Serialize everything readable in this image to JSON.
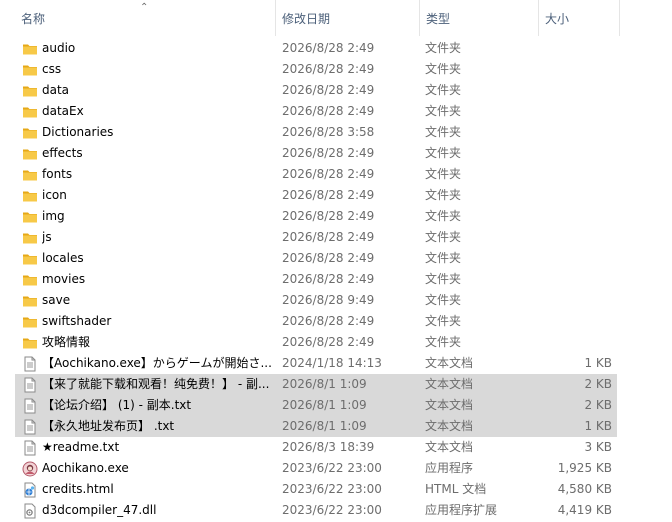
{
  "columns": {
    "name": "名称",
    "date": "修改日期",
    "type": "类型",
    "size": "大小"
  },
  "colors": {
    "folder": "#f7c948",
    "folder_dark": "#e6a817",
    "header_text": "#4c607a",
    "selection": "#d9d9d9"
  },
  "rows": [
    {
      "name": "audio",
      "date": "2026/8/28 2:49",
      "type": "文件夹",
      "size": "",
      "icon": "folder-icon",
      "selected": false
    },
    {
      "name": "css",
      "date": "2026/8/28 2:49",
      "type": "文件夹",
      "size": "",
      "icon": "folder-icon",
      "selected": false
    },
    {
      "name": "data",
      "date": "2026/8/28 2:49",
      "type": "文件夹",
      "size": "",
      "icon": "folder-icon",
      "selected": false
    },
    {
      "name": "dataEx",
      "date": "2026/8/28 2:49",
      "type": "文件夹",
      "size": "",
      "icon": "folder-icon",
      "selected": false
    },
    {
      "name": "Dictionaries",
      "date": "2026/8/28 3:58",
      "type": "文件夹",
      "size": "",
      "icon": "folder-icon",
      "selected": false
    },
    {
      "name": "effects",
      "date": "2026/8/28 2:49",
      "type": "文件夹",
      "size": "",
      "icon": "folder-icon",
      "selected": false
    },
    {
      "name": "fonts",
      "date": "2026/8/28 2:49",
      "type": "文件夹",
      "size": "",
      "icon": "folder-icon",
      "selected": false
    },
    {
      "name": "icon",
      "date": "2026/8/28 2:49",
      "type": "文件夹",
      "size": "",
      "icon": "folder-icon",
      "selected": false
    },
    {
      "name": "img",
      "date": "2026/8/28 2:49",
      "type": "文件夹",
      "size": "",
      "icon": "folder-icon",
      "selected": false
    },
    {
      "name": "js",
      "date": "2026/8/28 2:49",
      "type": "文件夹",
      "size": "",
      "icon": "folder-icon",
      "selected": false
    },
    {
      "name": "locales",
      "date": "2026/8/28 2:49",
      "type": "文件夹",
      "size": "",
      "icon": "folder-icon",
      "selected": false
    },
    {
      "name": "movies",
      "date": "2026/8/28 2:49",
      "type": "文件夹",
      "size": "",
      "icon": "folder-icon",
      "selected": false
    },
    {
      "name": "save",
      "date": "2026/8/28 9:49",
      "type": "文件夹",
      "size": "",
      "icon": "folder-icon",
      "selected": false
    },
    {
      "name": "swiftshader",
      "date": "2026/8/28 2:49",
      "type": "文件夹",
      "size": "",
      "icon": "folder-icon",
      "selected": false
    },
    {
      "name": "攻略情報",
      "date": "2026/8/28 2:49",
      "type": "文件夹",
      "size": "",
      "icon": "folder-icon",
      "selected": false
    },
    {
      "name": "【Aochikano.exe】からゲームが開始さ...",
      "date": "2024/1/18 14:13",
      "type": "文本文档",
      "size": "1 KB",
      "icon": "text-file-icon",
      "selected": false
    },
    {
      "name": "【来了就能下载和观看！纯免费！】 - 副...",
      "date": "2026/8/1 1:09",
      "type": "文本文档",
      "size": "2 KB",
      "icon": "text-file-icon",
      "selected": true
    },
    {
      "name": "【论坛介绍】 (1) - 副本.txt",
      "date": "2026/8/1 1:09",
      "type": "文本文档",
      "size": "2 KB",
      "icon": "text-file-icon",
      "selected": true
    },
    {
      "name": "【永久地址发布页】 .txt",
      "date": "2026/8/1 1:09",
      "type": "文本文档",
      "size": "1 KB",
      "icon": "text-file-icon",
      "selected": true
    },
    {
      "name": "★readme.txt",
      "date": "2026/8/3 18:39",
      "type": "文本文档",
      "size": "3 KB",
      "icon": "text-file-icon",
      "selected": false
    },
    {
      "name": "Aochikano.exe",
      "date": "2023/6/22 23:00",
      "type": "应用程序",
      "size": "1,925 KB",
      "icon": "app-icon",
      "selected": false
    },
    {
      "name": "credits.html",
      "date": "2023/6/22 23:00",
      "type": "HTML 文档",
      "size": "4,580 KB",
      "icon": "html-file-icon",
      "selected": false
    },
    {
      "name": "d3dcompiler_47.dll",
      "date": "2023/6/22 23:00",
      "type": "应用程序扩展",
      "size": "4,419 KB",
      "icon": "dll-file-icon",
      "selected": false
    }
  ]
}
